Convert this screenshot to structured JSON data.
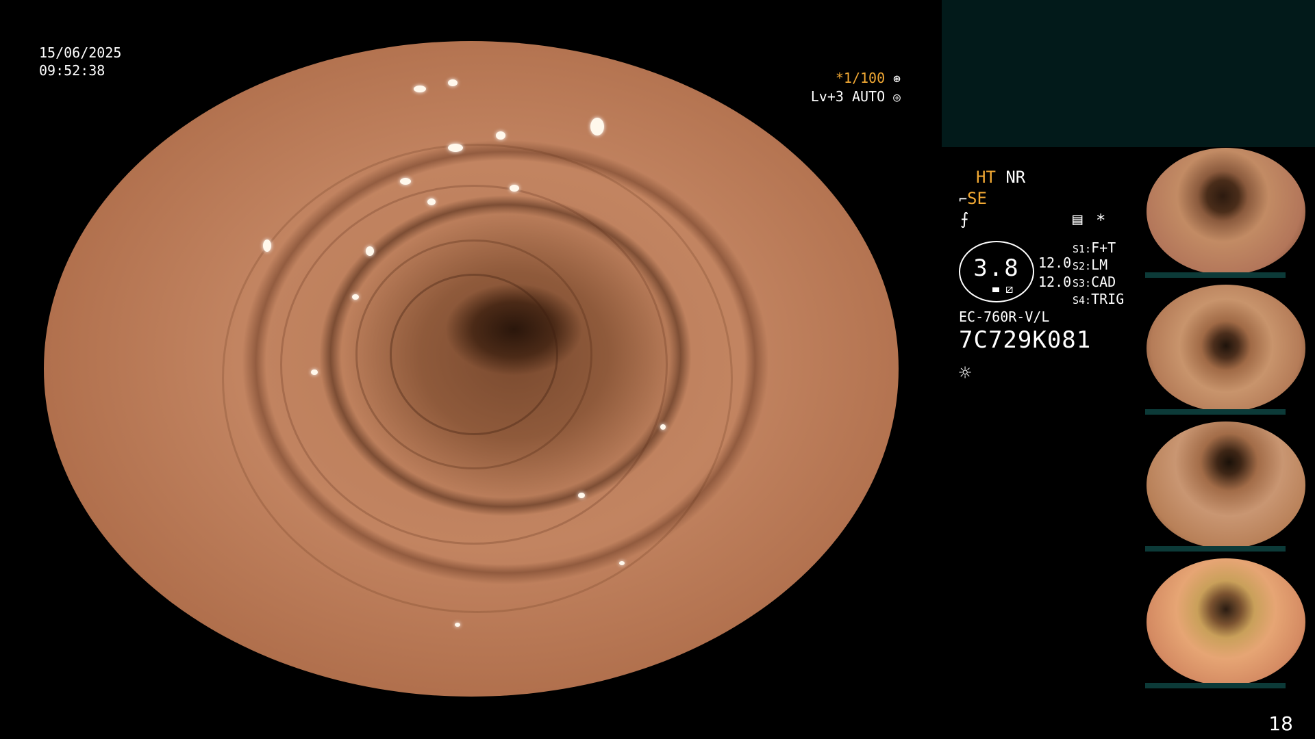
{
  "overlay": {
    "date": "15/06/2025",
    "time": "09:52:38",
    "shutter": "*1/100",
    "shutter_icon": "aperture-icon",
    "level": "Lv+3 AUTO",
    "level_icon": "iris-icon"
  },
  "status": {
    "ht": "HT",
    "nr": "NR",
    "se": "SE",
    "star": "*",
    "gauge_value": "3.8",
    "val_a": "12.0",
    "val_b": "12.0",
    "s1_key": "S1:",
    "s1_val": "F+T",
    "s2_key": "S2:",
    "s2_val": "LM",
    "s3_key": "S3:",
    "s3_val": "CAD",
    "s4_key": "S4:",
    "s4_val": "TRIG",
    "scope_model": "EC-760R-V/L",
    "scope_serial": "7C729K081"
  },
  "colors": {
    "accent_orange": "#f2a934",
    "panel_teal": "#021a1a",
    "thumb_bar": "#0c3a38"
  },
  "thumbnails": [
    {
      "label": "thumbnail-1"
    },
    {
      "label": "thumbnail-2"
    },
    {
      "label": "thumbnail-3"
    },
    {
      "label": "thumbnail-4"
    }
  ],
  "page_number": "18"
}
